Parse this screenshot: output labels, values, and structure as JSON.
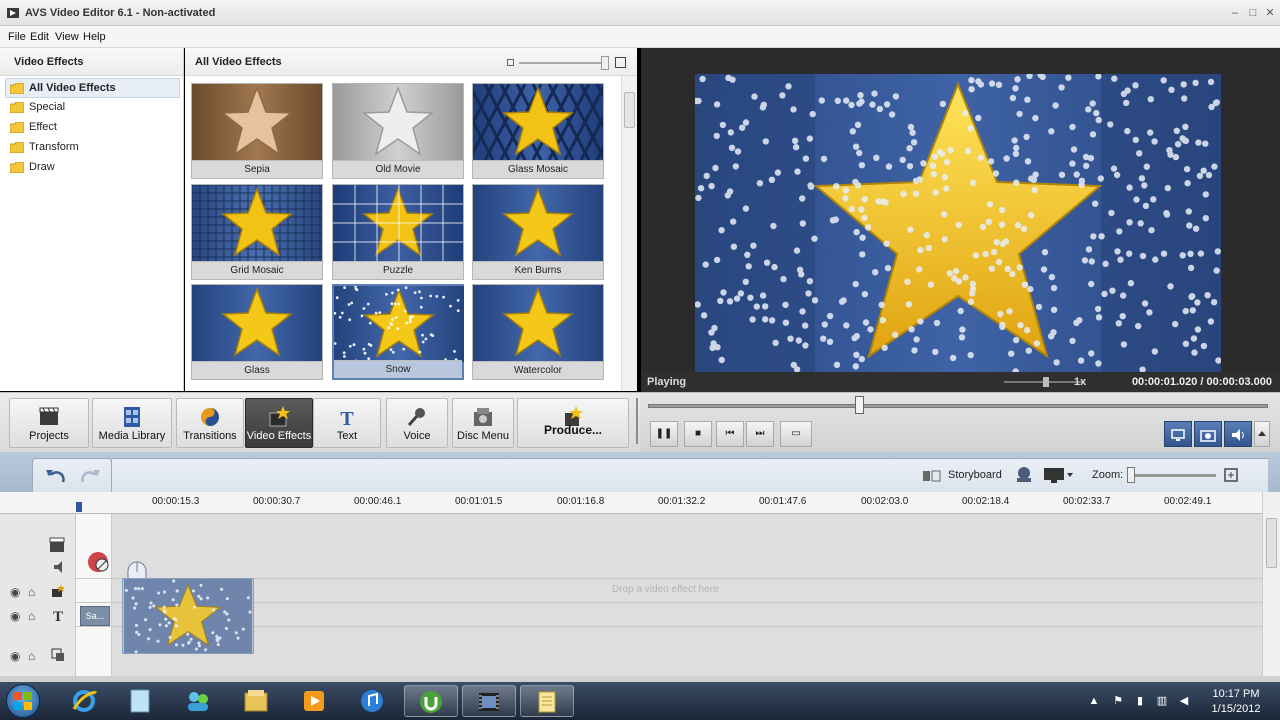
{
  "window": {
    "title": "AVS Video Editor 6.1 - Non-activated",
    "minimize": "‒",
    "maximize": "□",
    "close": "✕"
  },
  "menu": [
    "File",
    "Edit",
    "View",
    "Help"
  ],
  "left_panel": {
    "header": "Video Effects",
    "items": [
      {
        "label": "All Video Effects",
        "selected": true
      },
      {
        "label": "Special",
        "selected": false
      },
      {
        "label": "Effect",
        "selected": false
      },
      {
        "label": "Transform",
        "selected": false
      },
      {
        "label": "Draw",
        "selected": false
      }
    ]
  },
  "effects": {
    "header": "All Video Effects",
    "tiles": [
      {
        "label": "Sepia",
        "style": "sepia"
      },
      {
        "label": "Old Movie",
        "style": "gray"
      },
      {
        "label": "Glass Mosaic",
        "style": "mosaic"
      },
      {
        "label": "Grid Mosaic",
        "style": "grid"
      },
      {
        "label": "Puzzle",
        "style": "puzzle"
      },
      {
        "label": "Ken Burns",
        "style": "blue"
      },
      {
        "label": "Glass",
        "style": "blue"
      },
      {
        "label": "Snow",
        "style": "snow",
        "selected": true
      },
      {
        "label": "Watercolor",
        "style": "blue"
      }
    ]
  },
  "preview": {
    "status": "Playing",
    "speed": "1x",
    "time": "00:00:01.020 / 00:00:03.000",
    "progress_fraction": 0.34
  },
  "toolbar": [
    {
      "label": "Projects",
      "icon": "projects-icon"
    },
    {
      "label": "Media Library",
      "icon": "media-library-icon"
    },
    {
      "label": "Transitions",
      "icon": "transitions-icon"
    },
    {
      "label": "Video Effects",
      "icon": "video-effects-icon",
      "active": true
    },
    {
      "label": "Text",
      "icon": "text-icon"
    },
    {
      "label": "Voice",
      "icon": "voice-icon"
    },
    {
      "label": "Disc Menu",
      "icon": "disc-menu-icon"
    },
    {
      "label": "Produce...",
      "icon": "produce-icon"
    }
  ],
  "playback": {
    "pause": "❚❚",
    "stop": "■",
    "prev": "⏮",
    "next": "⏭",
    "mode": "▭"
  },
  "timeline": {
    "storyboard_label": "Storyboard",
    "zoom_label": "Zoom:",
    "ruler": [
      "00:00:15.3",
      "00:00:30.7",
      "00:00:46.1",
      "00:01:01.5",
      "00:01:16.8",
      "00:01:32.2",
      "00:01:47.6",
      "00:02:03.0",
      "00:02:18.4",
      "00:02:33.7",
      "00:02:49.1"
    ],
    "drop_hint": "Drop a video effect here",
    "text_clip_label": "Sa..."
  },
  "taskbar": {
    "time": "10:17 PM",
    "date": "1/15/2012"
  },
  "colors": {
    "preview_blue": "#2f4f8e",
    "star_yellow": "#f2c315",
    "active_button": "#3c3c3c"
  }
}
